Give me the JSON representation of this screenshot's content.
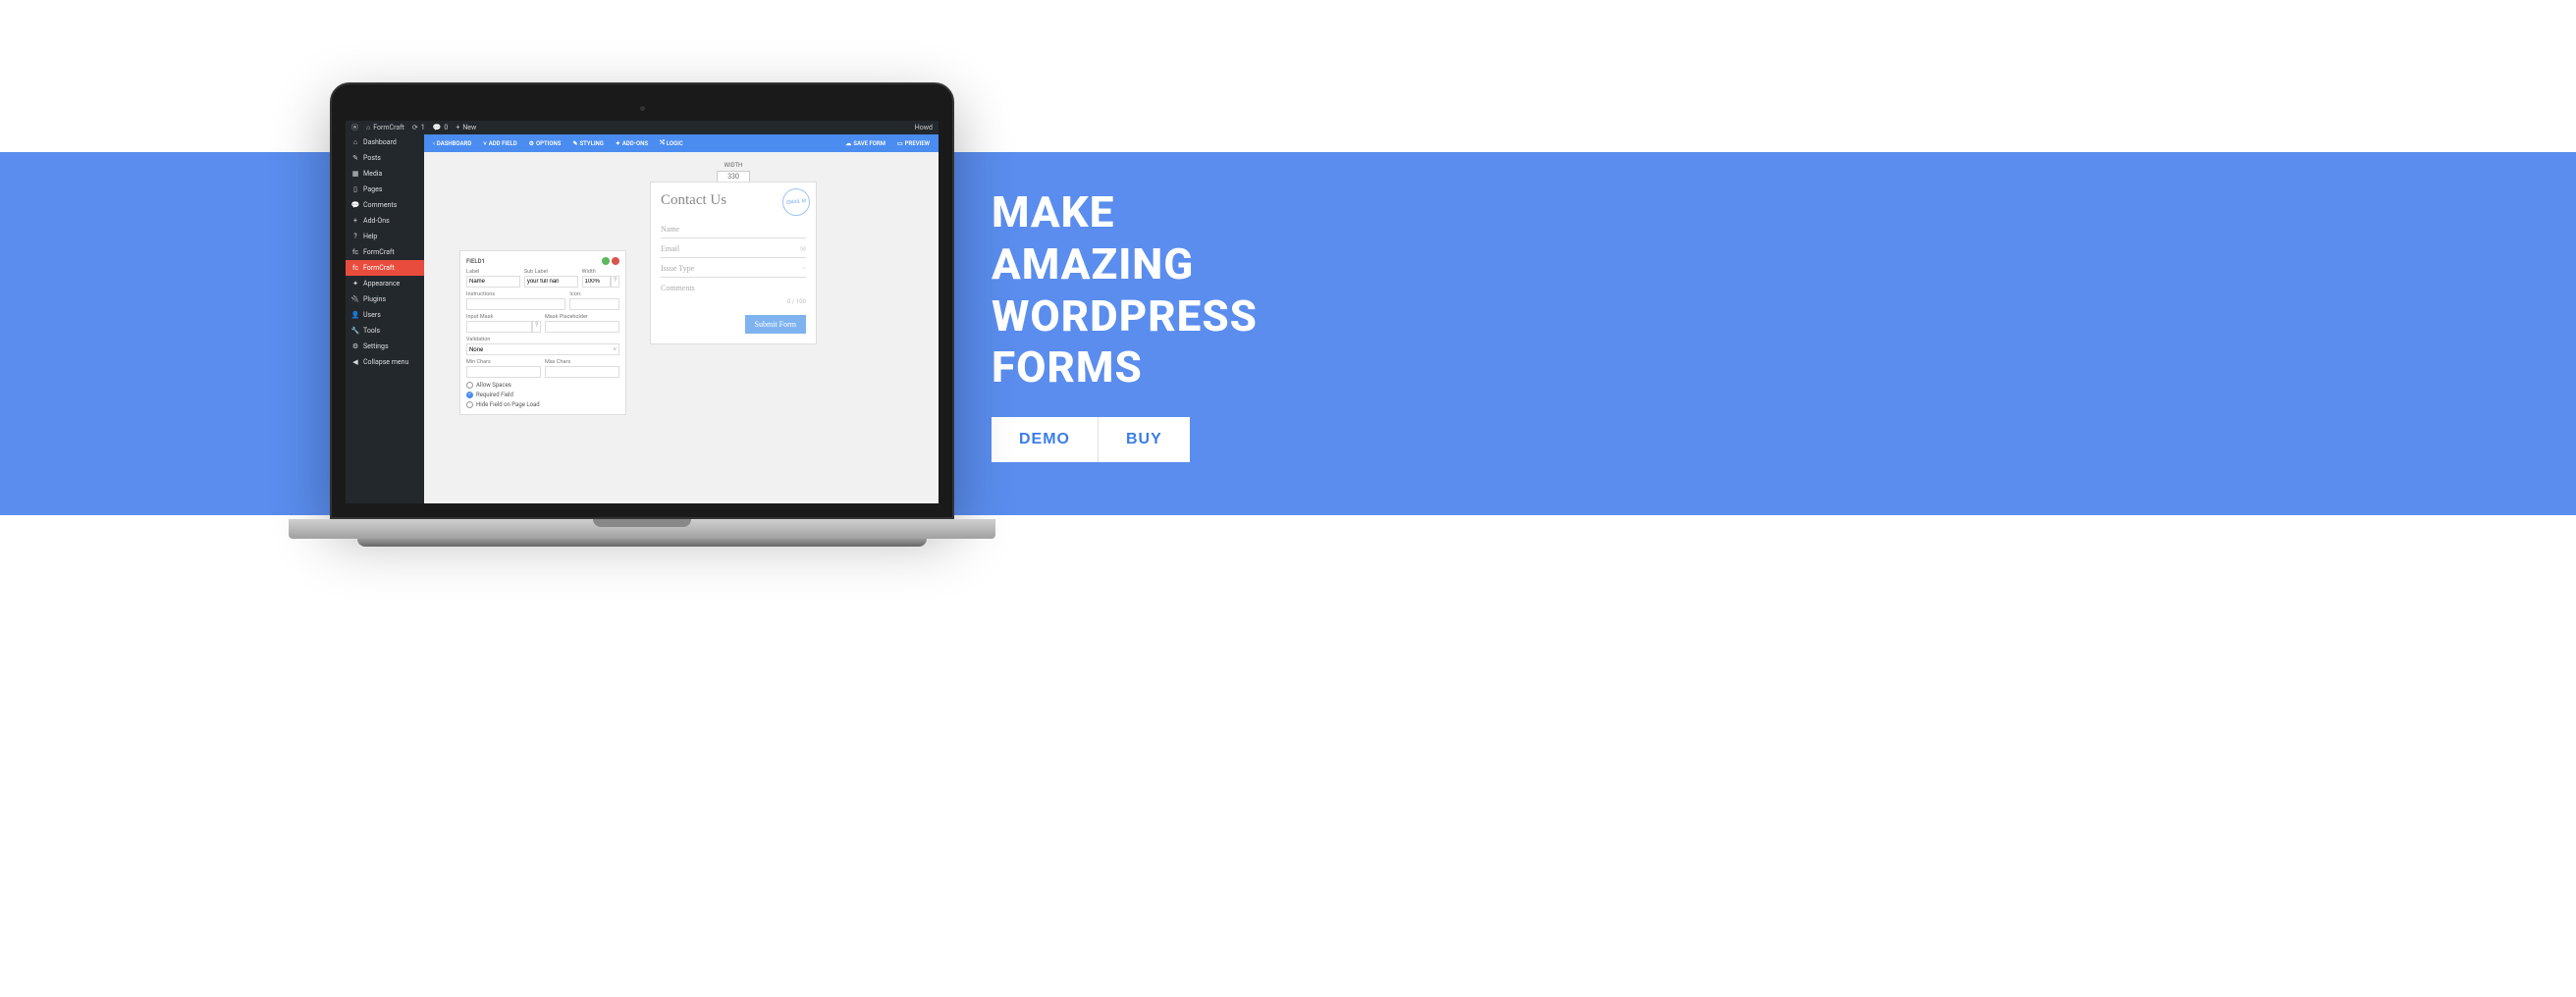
{
  "hero": {
    "line1": "MAKE",
    "line2": "AMAZING",
    "line3": "WORDPRESS",
    "line4": "FORMS",
    "demo_btn": "DEMO",
    "buy_btn": "BUY"
  },
  "wp_bar": {
    "site": "FormCraft",
    "updates": "1",
    "comments": "0",
    "new": "New",
    "user": "Howd"
  },
  "sidebar": {
    "items": [
      {
        "icon": "⌂",
        "label": "Dashboard"
      },
      {
        "icon": "✎",
        "label": "Posts"
      },
      {
        "icon": "▦",
        "label": "Media"
      },
      {
        "icon": "▯",
        "label": "Pages"
      },
      {
        "icon": "💬",
        "label": "Comments"
      },
      {
        "icon": "+",
        "label": "Add-Ons"
      },
      {
        "icon": "?",
        "label": "Help"
      },
      {
        "icon": "fc",
        "label": "FormCraft"
      },
      {
        "icon": "fc",
        "label": "FormCraft"
      },
      {
        "icon": "✦",
        "label": "Appearance"
      },
      {
        "icon": "🔌",
        "label": "Plugins"
      },
      {
        "icon": "👤",
        "label": "Users"
      },
      {
        "icon": "🔧",
        "label": "Tools"
      },
      {
        "icon": "⚙",
        "label": "Settings"
      },
      {
        "icon": "◀",
        "label": "Collapse menu"
      }
    ]
  },
  "toolbar": {
    "dashboard": "DASHBOARD",
    "add_field": "ADD FIELD",
    "options": "OPTIONS",
    "styling": "STYLING",
    "addons": "ADD-ONS",
    "logic": "LOGIC",
    "save": "SAVE FORM",
    "preview": "PREVIEW"
  },
  "width_label": "WIDTH",
  "width_value": "330",
  "field_panel": {
    "title": "FIELD1",
    "label_lbl": "Label",
    "label_val": "Name",
    "sublabel_lbl": "Sub Label",
    "sublabel_val": "your full nan",
    "width_lbl": "Width",
    "width_val": "100%",
    "width_hint": "?",
    "instructions_lbl": "Instructions",
    "icon_lbl": "Icon:",
    "inputmask_lbl": "Input Mask",
    "inputmask_hint": "?",
    "maskplaceholder_lbl": "Mask Placeholder",
    "validation_lbl": "Validation",
    "validation_val": "None",
    "minchars_lbl": "Min Chars",
    "maxchars_lbl": "Max Chars",
    "allow_spaces": "Allow Spaces",
    "required": "Required Field",
    "hide_load": "Hide Field on Page Load"
  },
  "form": {
    "title": "Contact Us",
    "stamp": "EMAIL M",
    "name": "Name",
    "email": "Email",
    "issue": "Issue Type",
    "comments": "Comments",
    "counter": "0 / 100",
    "submit": "Submit Form"
  }
}
